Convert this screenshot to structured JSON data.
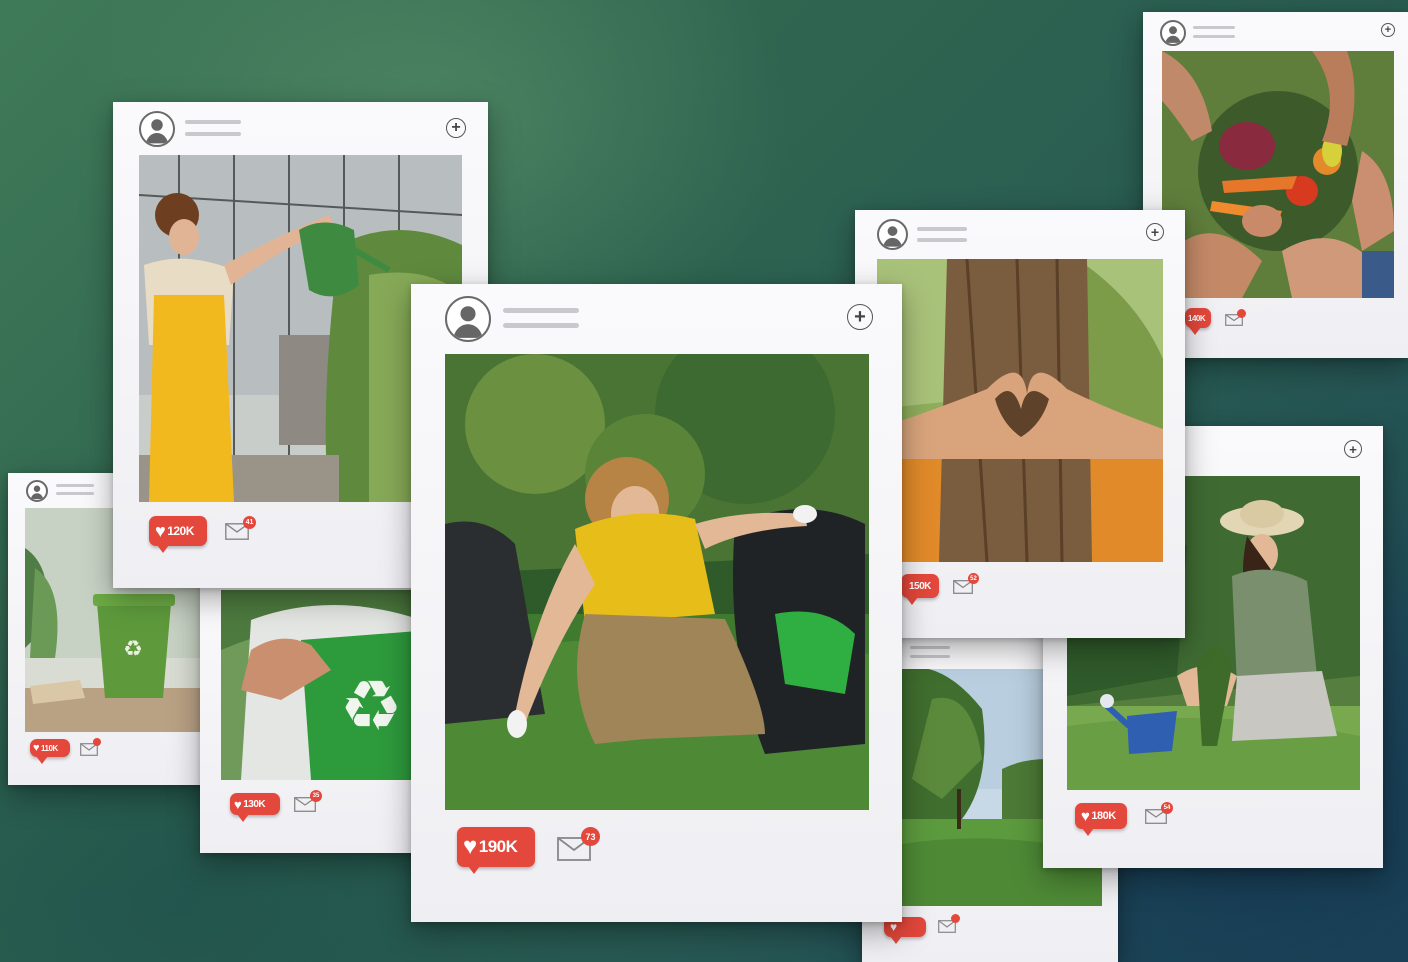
{
  "posts": [
    {
      "id": "recycle-bin",
      "likes": "110K",
      "comments": ""
    },
    {
      "id": "recycle-shirt",
      "likes": "130K",
      "comments": "35"
    },
    {
      "id": "watering",
      "likes": "120K",
      "comments": "41"
    },
    {
      "id": "vegetables",
      "likes": "140K",
      "comments": ""
    },
    {
      "id": "tree-heart",
      "likes": "150K",
      "comments": "52"
    },
    {
      "id": "park",
      "likes": "",
      "comments": ""
    },
    {
      "id": "gardening",
      "likes": "180K",
      "comments": "54"
    },
    {
      "id": "cleanup",
      "likes": "190K",
      "comments": "73"
    }
  ],
  "icons": {
    "avatar": "user-avatar-icon",
    "add": "plus-circle-icon",
    "like": "heart-icon",
    "message": "envelope-icon"
  },
  "colors": {
    "accent": "#e4473b",
    "card": "#f2f2f5",
    "background": "#2f6550"
  }
}
